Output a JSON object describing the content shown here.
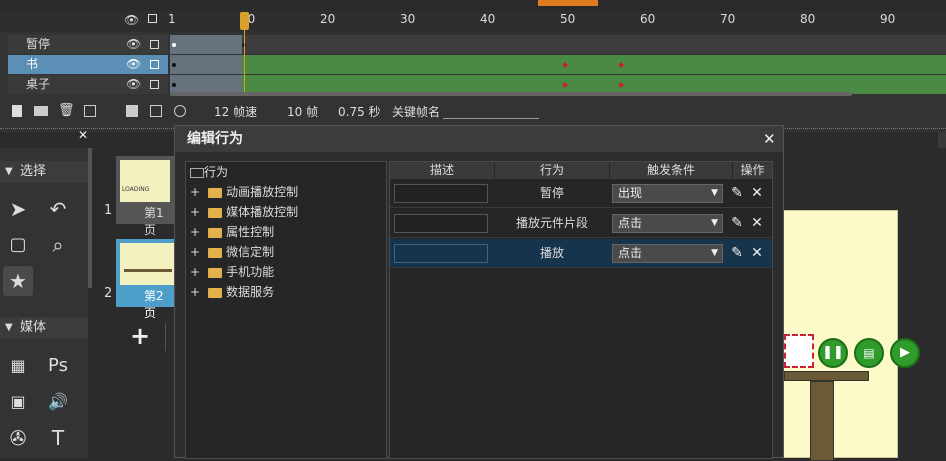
{
  "timeline": {
    "ruler_ticks": [
      "1",
      "10",
      "20",
      "30",
      "40",
      "50",
      "60",
      "70",
      "80",
      "90"
    ],
    "layers": [
      {
        "name": "暂停",
        "selected": false
      },
      {
        "name": "书",
        "selected": true
      },
      {
        "name": "桌子",
        "selected": false
      }
    ],
    "fps": "12 帧速",
    "frames": "10 帧",
    "seconds": "0.75 秒",
    "keyframe_name_label": "关键帧名"
  },
  "left_panel": {
    "section_select": "选择",
    "section_media": "媒体"
  },
  "pages": {
    "items": [
      {
        "number": "1",
        "label": "第1页",
        "thumb_text": "LOADING"
      },
      {
        "number": "2",
        "label": "第2页"
      }
    ],
    "add_label": "+"
  },
  "dialog": {
    "title": "编辑行为",
    "close_label": "✕",
    "tree_root": "行为",
    "tree_items": [
      "动画播放控制",
      "媒体播放控制",
      "属性控制",
      "微信定制",
      "手机功能",
      "数据服务"
    ],
    "columns": [
      "描述",
      "行为",
      "触发条件",
      "操作"
    ],
    "rows": [
      {
        "description": "",
        "action": "暂停",
        "trigger": "出现",
        "selected": false
      },
      {
        "description": "",
        "action": "播放元件片段",
        "trigger": "点击",
        "selected": false
      },
      {
        "description": "",
        "action": "播放",
        "trigger": "点击",
        "selected": true
      }
    ]
  },
  "icons": {
    "eye": "eye-icon",
    "lock": "lock-icon",
    "pencil": "pencil-icon",
    "delete": "close-icon",
    "ps": "Ps",
    "text_tool": "T"
  },
  "colors": {
    "frames_green": "#4a8a44",
    "selected_layer": "#5b8fb6",
    "playhead": "#d8a02c",
    "selected_row": "#17344d"
  }
}
